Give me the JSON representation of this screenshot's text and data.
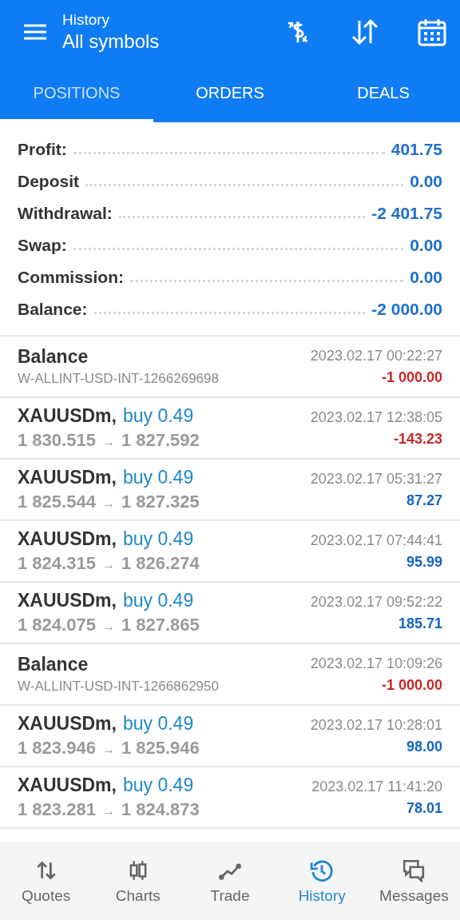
{
  "header": {
    "subtitle": "History",
    "title": "All symbols"
  },
  "tabs": [
    {
      "label": "POSITIONS",
      "selected": true
    },
    {
      "label": "ORDERS",
      "selected": false
    },
    {
      "label": "DEALS",
      "selected": false
    }
  ],
  "summary": [
    {
      "label": "Profit:",
      "value": "401.75"
    },
    {
      "label": "Deposit",
      "value": "0.00"
    },
    {
      "label": "Withdrawal:",
      "value": "-2 401.75"
    },
    {
      "label": "Swap:",
      "value": "0.00"
    },
    {
      "label": "Commission:",
      "value": "0.00"
    },
    {
      "label": "Balance:",
      "value": "-2 000.00"
    }
  ],
  "deals": [
    {
      "kind": "balance",
      "title": "Balance",
      "comment": "W-ALLINT-USD-INT-1266269698",
      "time": "2023.02.17 00:22:27",
      "profit": "-1 000.00",
      "color": "#c62828"
    },
    {
      "kind": "trade",
      "symbol": "XAUUSDm,",
      "action": "buy 0.49",
      "open_price": "1 830.515",
      "arrow": "→",
      "close_price": "1 827.592",
      "time": "2023.02.17 12:38:05",
      "profit": "-143.23",
      "color": "#c62828"
    },
    {
      "kind": "trade",
      "symbol": "XAUUSDm,",
      "action": "buy 0.49",
      "open_price": "1 825.544",
      "arrow": "→",
      "close_price": "1 827.325",
      "time": "2023.02.17 05:31:27",
      "profit": "87.27",
      "color": "#1565c0"
    },
    {
      "kind": "trade",
      "symbol": "XAUUSDm,",
      "action": "buy 0.49",
      "open_price": "1 824.315",
      "arrow": "→",
      "close_price": "1 826.274",
      "time": "2023.02.17 07:44:41",
      "profit": "95.99",
      "color": "#1565c0"
    },
    {
      "kind": "trade",
      "symbol": "XAUUSDm,",
      "action": "buy 0.49",
      "open_price": "1 824.075",
      "arrow": "→",
      "close_price": "1 827.865",
      "time": "2023.02.17 09:52:22",
      "profit": "185.71",
      "color": "#1565c0"
    },
    {
      "kind": "balance",
      "title": "Balance",
      "comment": "W-ALLINT-USD-INT-1266862950",
      "time": "2023.02.17 10:09:26",
      "profit": "-1 000.00",
      "color": "#c62828"
    },
    {
      "kind": "trade",
      "symbol": "XAUUSDm,",
      "action": "buy 0.49",
      "open_price": "1 823.946",
      "arrow": "→",
      "close_price": "1 825.946",
      "time": "2023.02.17 10:28:01",
      "profit": "98.00",
      "color": "#1565c0"
    },
    {
      "kind": "trade",
      "symbol": "XAUUSDm,",
      "action": "buy 0.49",
      "open_price": "1 823.281",
      "arrow": "→",
      "close_price": "1 824.873",
      "time": "2023.02.17 11:41:20",
      "profit": "78.01",
      "color": "#1565c0"
    }
  ],
  "nav": [
    {
      "kind": "quotes",
      "label": "Quotes",
      "selected": false
    },
    {
      "kind": "charts",
      "label": "Charts",
      "selected": false
    },
    {
      "kind": "trade",
      "label": "Trade",
      "selected": false
    },
    {
      "kind": "history",
      "label": "History",
      "selected": true
    },
    {
      "kind": "messages",
      "label": "Messages",
      "selected": false
    }
  ]
}
